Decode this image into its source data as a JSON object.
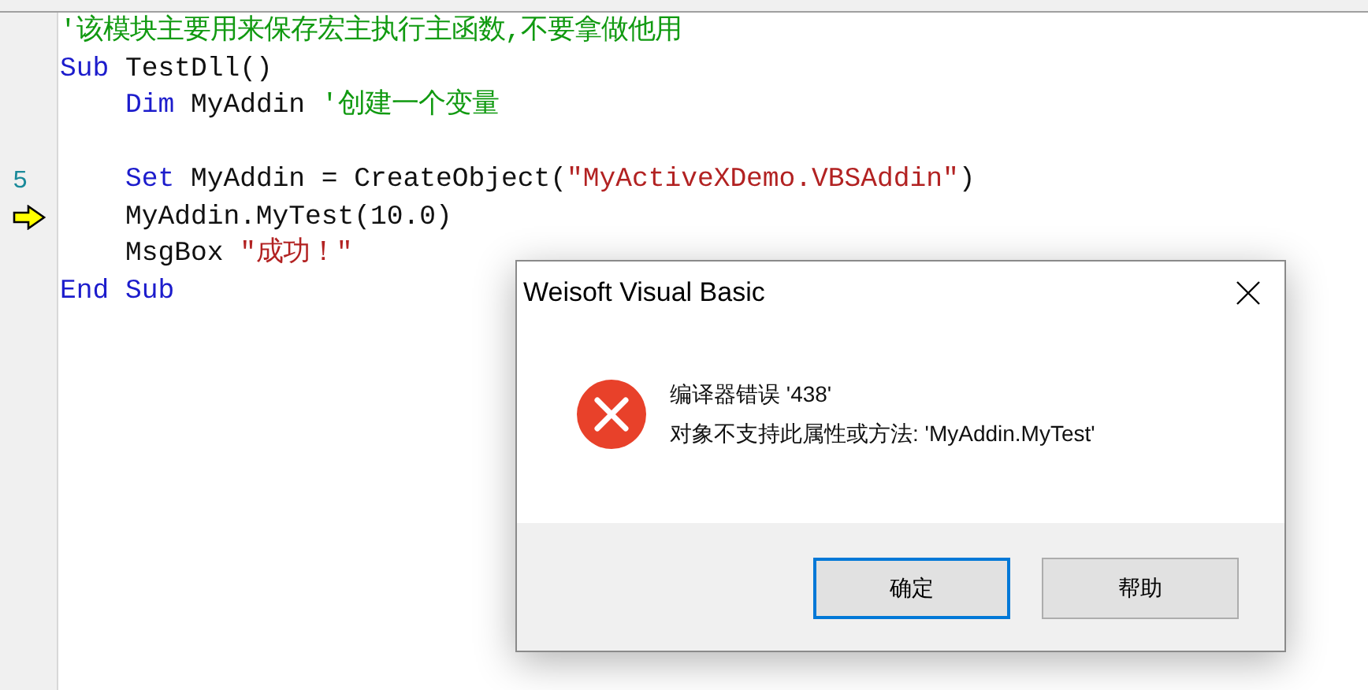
{
  "editor": {
    "lines": [
      {
        "current": false,
        "indented": false,
        "tokens": [
          {
            "kind": "comment",
            "text": "'该模块主要用来保存宏主执行主函数,不要拿做他用"
          }
        ]
      },
      {
        "current": false,
        "indented": false,
        "tokens": [
          {
            "kind": "keyword",
            "text": "Sub"
          },
          {
            "kind": "plain",
            "text": " TestDll()"
          }
        ]
      },
      {
        "current": false,
        "indented": true,
        "tokens": [
          {
            "kind": "keyword",
            "text": "Dim"
          },
          {
            "kind": "plain",
            "text": " MyAddin "
          },
          {
            "kind": "comment",
            "text": "'创建一个变量"
          }
        ]
      },
      {
        "current": false
      },
      {
        "gutter": "5",
        "current": false,
        "indented": true,
        "tokens": [
          {
            "kind": "keyword",
            "text": "Set"
          },
          {
            "kind": "plain",
            "text": " MyAddin = CreateObject("
          },
          {
            "kind": "string",
            "text": "\"MyActiveXDemo.VBSAddin\""
          },
          {
            "kind": "plain",
            "text": ")"
          }
        ]
      },
      {
        "current": true,
        "indented": true,
        "tokens": [
          {
            "kind": "plain",
            "text": "MyAddin.MyTest(10.0)"
          }
        ]
      },
      {
        "current": false,
        "indented": true,
        "tokens": [
          {
            "kind": "plain",
            "text": "MsgBox "
          },
          {
            "kind": "string",
            "text": "\"成功！\""
          }
        ]
      },
      {
        "current": false,
        "indented": false,
        "tokens": [
          {
            "kind": "keyword",
            "text": "End Sub"
          }
        ]
      }
    ]
  },
  "dialog": {
    "title": "Weisoft Visual Basic",
    "message_lines": [
      "编译器错误 '438'",
      "对象不支持此属性或方法: 'MyAddin.MyTest'"
    ],
    "buttons": [
      {
        "label": "确定",
        "selected": true
      },
      {
        "label": "帮助",
        "selected": false
      }
    ]
  }
}
